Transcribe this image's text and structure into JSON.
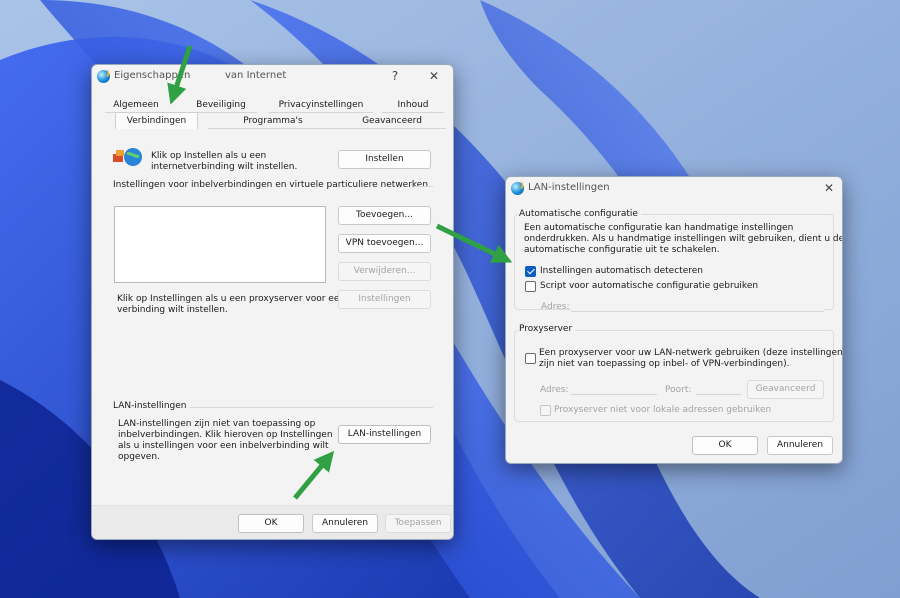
{
  "internet_dialog": {
    "title_left": "Eigenschappen",
    "title_right": "van Internet",
    "help_label": "?",
    "close_label": "✕",
    "tabs_row1": [
      "Algemeen",
      "Beveiliging",
      "Privacyinstellingen",
      "Inhoud"
    ],
    "tabs_row2": [
      "Verbindingen",
      "Programma's",
      "Geavanceerd"
    ],
    "active_tab": "Verbindingen",
    "setup_text_line1": "Klik op Instellen als u een",
    "setup_text_line2": "internetverbinding wilt instellen.",
    "setup_button": "Instellen",
    "dialup_header": "Instellingen voor inbelverbindingen en virtuele particuliere netwerken",
    "add_button": "Toevoegen...",
    "add_vpn_button": "VPN toevoegen...",
    "remove_button": "Verwijderen...",
    "proxy_text_line1": "Klik op Instellingen als u een proxyserver voor een",
    "proxy_text_line2": "verbinding wilt instellen.",
    "settings_button": "Instellingen",
    "lan_header": "LAN-instellingen",
    "lan_text_line1": "LAN-instellingen zijn niet van toepassing op",
    "lan_text_line2": "inbelverbindingen. Klik hieroven op Instellingen",
    "lan_text_line3": "als u instellingen voor een inbelverbinding wilt",
    "lan_text_line4": "opgeven.",
    "lan_button": "LAN-instellingen",
    "ok_button": "OK",
    "cancel_button": "Annuleren",
    "apply_button": "Toepassen"
  },
  "lan_dialog": {
    "title": "LAN-instellingen",
    "close_label": "✕",
    "auto_group_title": "Automatische configuratie",
    "auto_text_line1": "Een automatische configuratie kan handmatige instellingen",
    "auto_text_line2": "onderdrukken. Als u handmatige instellingen wilt gebruiken, dient u de",
    "auto_text_line3": "automatische configuratie uit te schakelen.",
    "auto_detect_label": "Instellingen automatisch detecteren",
    "auto_detect_checked": true,
    "script_label": "Script voor automatische configuratie gebruiken",
    "script_checked": false,
    "address_label": "Adres:",
    "proxy_group_title": "Proxyserver",
    "proxy_label_line1": "Een proxyserver voor uw LAN-netwerk gebruiken (deze instellingen",
    "proxy_label_line2": "zijn niet van toepassing op inbel- of VPN-verbindingen).",
    "proxy_checked": false,
    "proxy_address_label": "Adres:",
    "port_label": "Poort:",
    "advanced_button": "Geavanceerd",
    "bypass_label": "Proxyserver niet voor lokale adressen gebruiken",
    "ok_button": "OK",
    "cancel_button": "Annuleren"
  },
  "colors": {
    "accent": "#0b5fbf",
    "arrow": "#2fa043",
    "wallpaper": "#8fb0de"
  }
}
